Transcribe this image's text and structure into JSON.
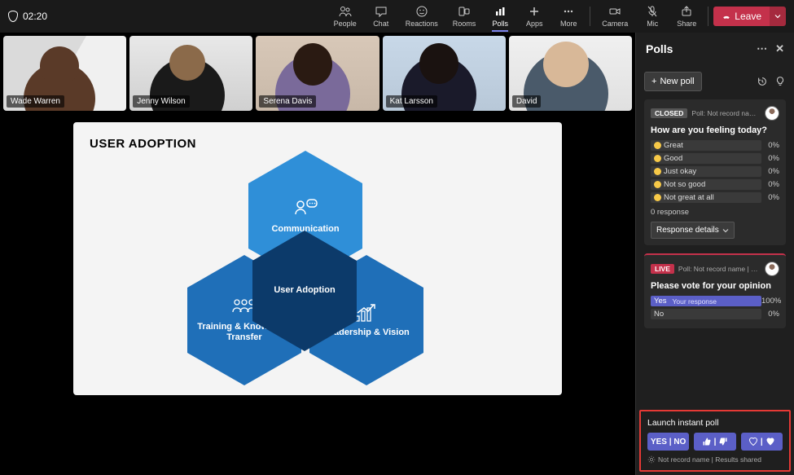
{
  "timer": "02:20",
  "toolbar": {
    "people": "People",
    "chat": "Chat",
    "reactions": "Reactions",
    "rooms": "Rooms",
    "polls": "Polls",
    "apps": "Apps",
    "more": "More",
    "camera": "Camera",
    "mic": "Mic",
    "share": "Share",
    "leave": "Leave"
  },
  "participants": [
    {
      "name": "Wade Warren"
    },
    {
      "name": "Jenny Wilson"
    },
    {
      "name": "Serena Davis"
    },
    {
      "name": "Kat Larsson"
    },
    {
      "name": "David"
    }
  ],
  "slide": {
    "title": "USER ADOPTION",
    "center": "User Adoption",
    "top": "Communication",
    "left": "Training & Knowledge Transfer",
    "right": "Leadership & Vision"
  },
  "panel": {
    "title": "Polls",
    "new_poll": "New poll"
  },
  "poll_closed": {
    "badge": "CLOSED",
    "meta": "Poll: Not record name | ...",
    "question": "How are you feeling today?",
    "options": [
      {
        "label": "Great",
        "pct": "0%"
      },
      {
        "label": "Good",
        "pct": "0%"
      },
      {
        "label": "Just okay",
        "pct": "0%"
      },
      {
        "label": "Not so good",
        "pct": "0%"
      },
      {
        "label": "Not great at all",
        "pct": "0%"
      }
    ],
    "responses": "0 response",
    "details": "Response details"
  },
  "poll_live": {
    "badge": "LIVE",
    "meta": "Poll: Not record name | Res...",
    "question": "Please vote for your opinion",
    "options": [
      {
        "label": "Yes",
        "pct": "100%",
        "your": "Your response"
      },
      {
        "label": "No",
        "pct": "0%"
      }
    ]
  },
  "launch": {
    "title": "Launch instant poll",
    "yesno": "YES | NO",
    "meta": "Not record name | Results shared"
  }
}
